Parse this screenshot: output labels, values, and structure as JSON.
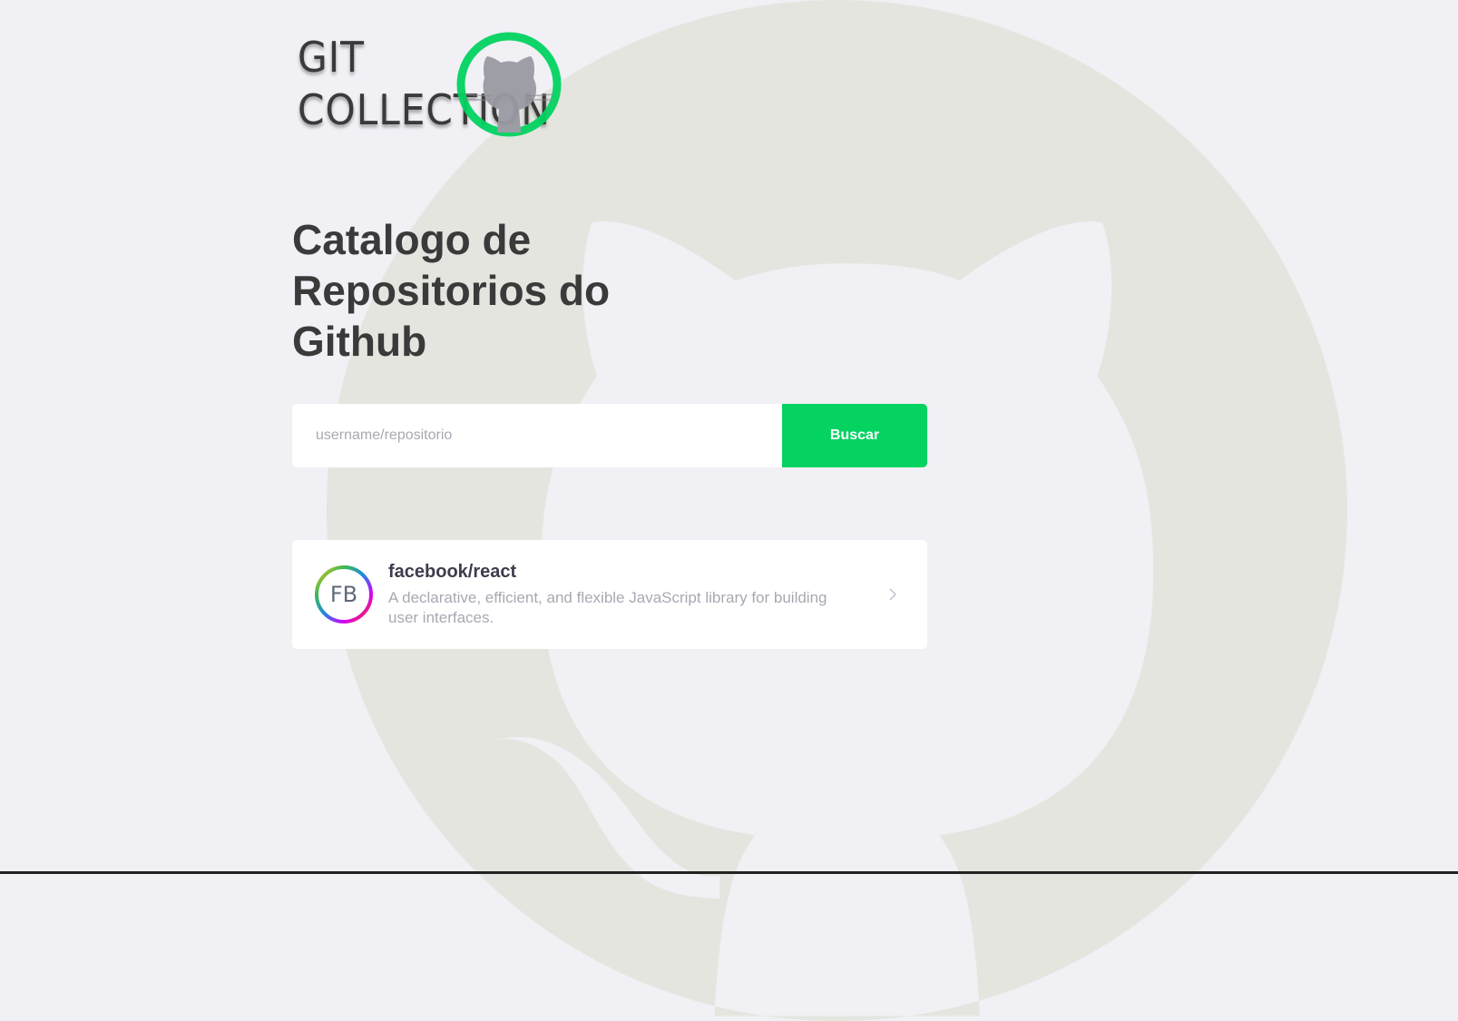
{
  "logo": {
    "line1": "GIT",
    "line2": "COLLECTION"
  },
  "page": {
    "title": "Catalogo de Repositorios do Github"
  },
  "search": {
    "placeholder": "username/repositorio",
    "value": "",
    "button_label": "Buscar"
  },
  "repositories": [
    {
      "name": "facebook/react",
      "description": "A declarative, efficient, and flexible JavaScript library for building user interfaces.",
      "avatar_text": "FB"
    }
  ],
  "icons": {
    "logo_mark": "octocat-ring-icon",
    "background": "octocat-icon",
    "repo_arrow": "chevron-right-icon"
  },
  "colors": {
    "page_background": "#f0f0f5",
    "watermark": "#e5e5e0",
    "accent_green": "#04d361",
    "title_text": "#3a3a3a",
    "muted_text": "#a8a8b3"
  }
}
